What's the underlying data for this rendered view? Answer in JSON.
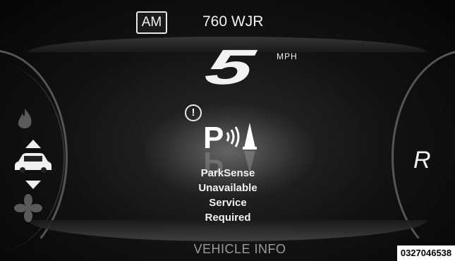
{
  "radio": {
    "band": "AM",
    "station": "760 WJR"
  },
  "speedometer": {
    "speed": "5",
    "unit": "MPH"
  },
  "gear": {
    "indicator": "R"
  },
  "parksense": {
    "icon": "parksense-icon",
    "warning_icon": "warning-circle-icon",
    "message_lines": [
      "ParkSense",
      "Unavailable",
      "Service",
      "Required"
    ]
  },
  "footer": {
    "label": "VEHICLE INFO"
  },
  "left_gauge": {
    "icons": [
      "flame-icon",
      "arrow-up-icon",
      "car-icon",
      "arrow-down-icon",
      "fan-icon"
    ]
  },
  "image_code": "0327046538",
  "colors": {
    "background": "#111111",
    "text": "#f2f2f2",
    "footer_text": "#9a9a9a"
  }
}
